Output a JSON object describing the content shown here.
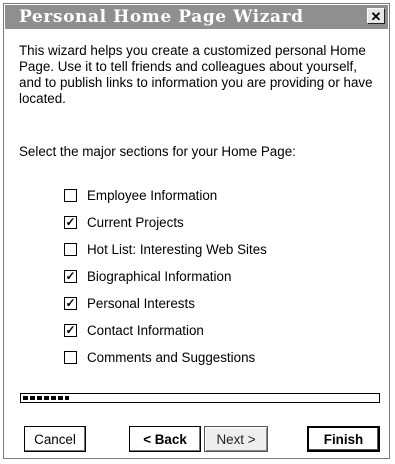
{
  "window": {
    "title": "Personal Home Page Wizard",
    "close_glyph": "✕"
  },
  "intro": "This wizard helps you create a customized personal Home Page. Use it to tell friends and colleagues about yourself, and to publish links to information you are providing or have located.",
  "prompt": "Select the major sections for your Home Page:",
  "sections": [
    {
      "label": "Employee Information",
      "checked": false
    },
    {
      "label": "Current Projects",
      "checked": true
    },
    {
      "label": "Hot List: Interesting Web Sites",
      "checked": false
    },
    {
      "label": "Biographical Information",
      "checked": true
    },
    {
      "label": "Personal Interests",
      "checked": true
    },
    {
      "label": "Contact Information",
      "checked": true
    },
    {
      "label": "Comments and Suggestions",
      "checked": false
    }
  ],
  "progress": {
    "fraction": 0.13
  },
  "buttons": {
    "cancel": "Cancel",
    "back": "< Back",
    "next": "Next >",
    "finish": "Finish"
  }
}
